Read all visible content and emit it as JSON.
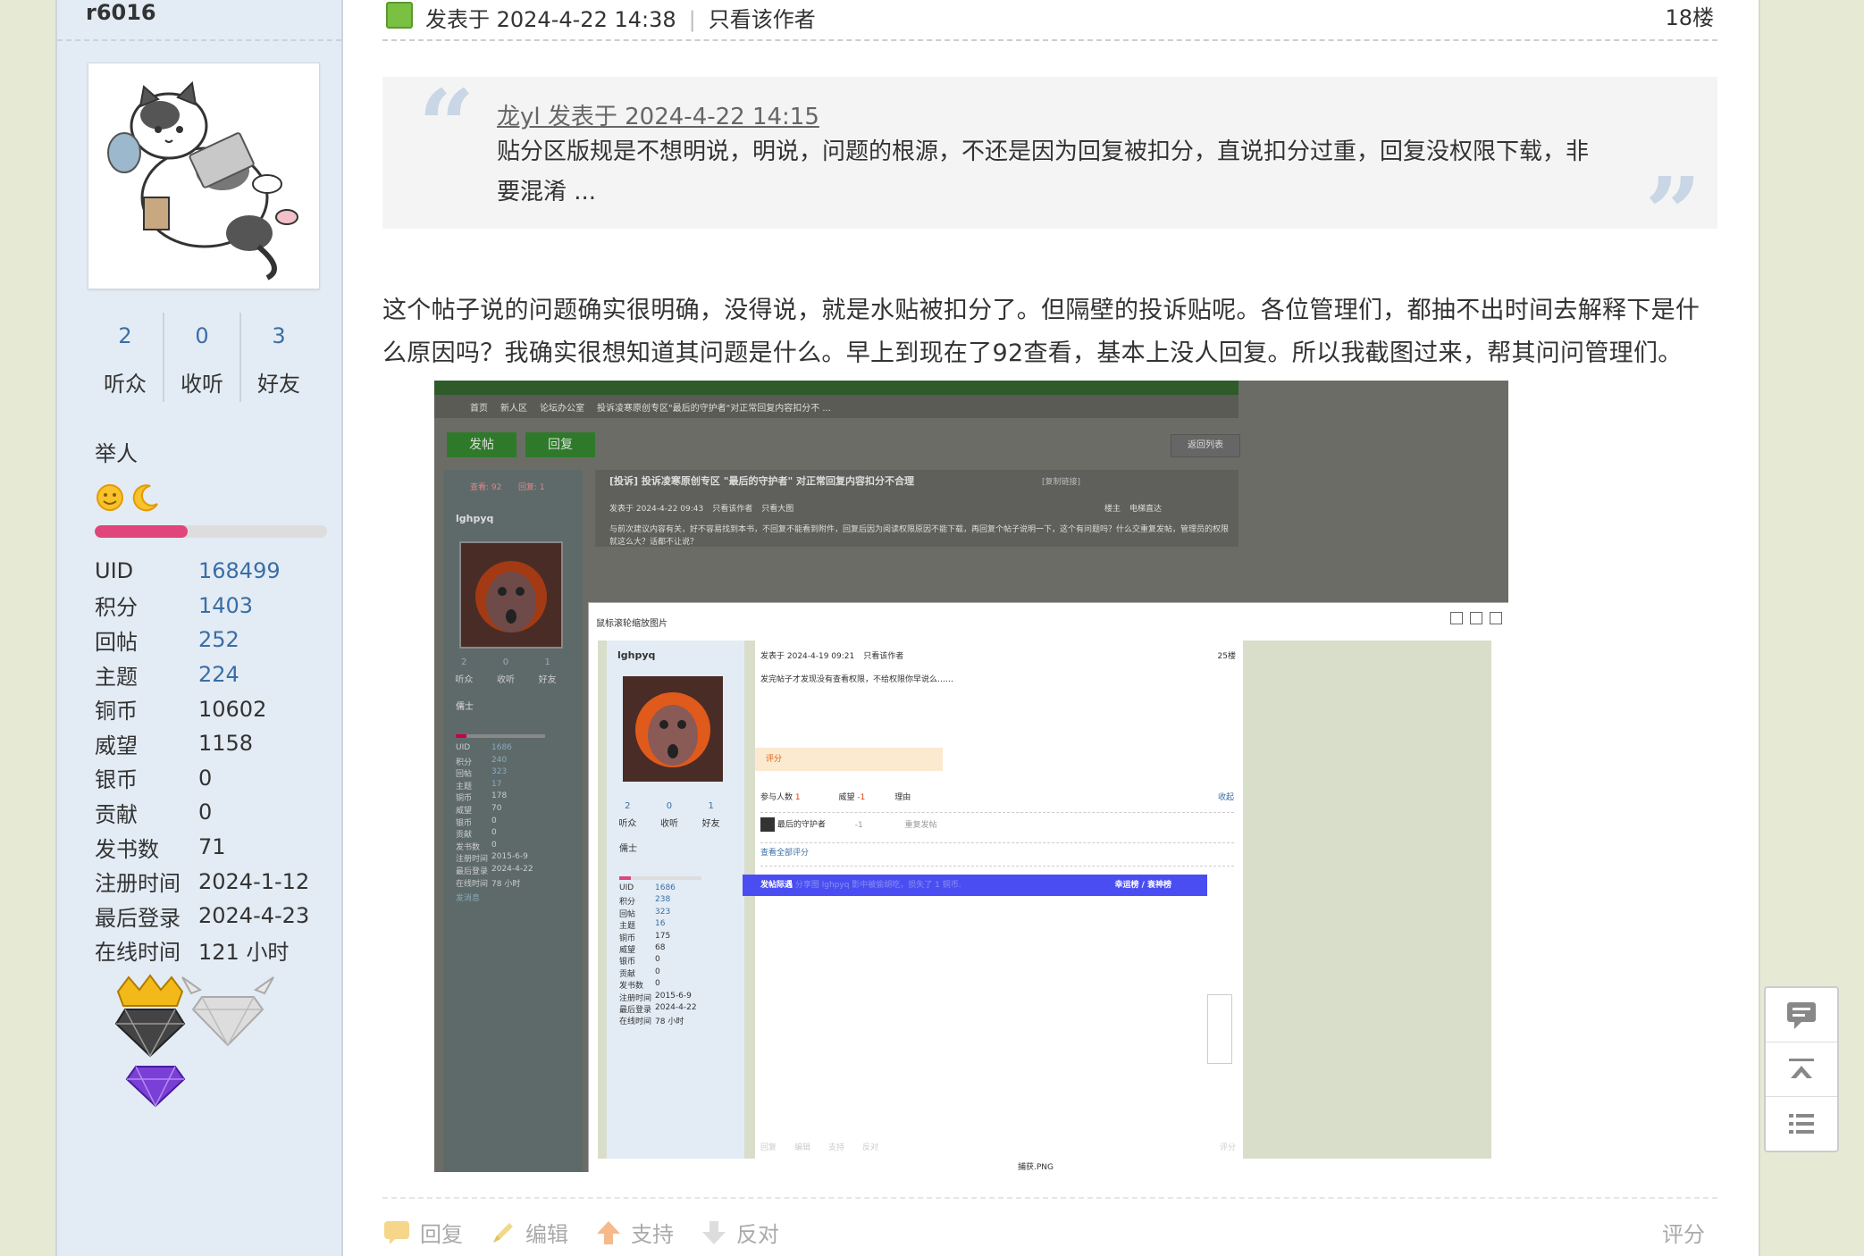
{
  "user": {
    "name": "r6016",
    "stats": [
      {
        "num": "2",
        "label": "听众"
      },
      {
        "num": "0",
        "label": "收听"
      },
      {
        "num": "3",
        "label": "好友"
      }
    ],
    "rank": "举人",
    "progress": 0.4,
    "info": [
      {
        "k": "UID",
        "v": "168499"
      },
      {
        "k": "积分",
        "v": "1403"
      },
      {
        "k": "回帖",
        "v": "252"
      },
      {
        "k": "主题",
        "v": "224"
      },
      {
        "k": "铜币",
        "v": "10602"
      },
      {
        "k": "威望",
        "v": "1158"
      },
      {
        "k": "银币",
        "v": "0"
      },
      {
        "k": "贡献",
        "v": "0"
      },
      {
        "k": "发书数",
        "v": "71"
      },
      {
        "k": "注册时间",
        "v": "2024-1-12"
      },
      {
        "k": "最后登录",
        "v": "2024-4-23"
      },
      {
        "k": "在线时间",
        "v": "121 小时"
      }
    ]
  },
  "post": {
    "posted": "发表于 2024-4-22 14:38",
    "only_author": "只看该作者",
    "floor": "18楼",
    "quote_author": "龙yl 发表于 2024-4-22 14:15",
    "quote_text": "贴分区版规是不想明说，明说，问题的根源，不还是因为回复被扣分，直说扣分过重，回复没权限下载，非要混淆 ...",
    "body": "这个帖子说的问题确实很明确，没得说，就是水贴被扣分了。但隔壁的投诉贴呢。各位管理们，都抽不出时间去解释下是什么原因吗？我确实很想知道其问题是什么。早上到现在了92查看，基本上没人回复。所以我截图过来，帮其问问管理们。",
    "actions": {
      "reply": "回复",
      "edit": "编辑",
      "support": "支持",
      "oppose": "反对"
    },
    "rate": "评分"
  },
  "screenshot": {
    "nav_home": "首页",
    "nav_new": "新人区",
    "nav_office": "论坛办公室",
    "nav_thread": "投诉凌寒原创专区\"最后的守护者\"对正常回复内容扣分不 ...",
    "btn_post": "发帖",
    "btn_reply": "回复",
    "back_list": "返回列表",
    "views": "查看: 92",
    "replies": "回复: 1",
    "thread_title": "[投诉] 投诉凌寒原创专区 \"最后的守护者\" 对正常回复内容扣分不合理",
    "copy_link": "[复制链接]",
    "author": "lghpyq",
    "posted": "发表于 2024-4-22 09:43",
    "only_author": "只看该作者",
    "big_img": "只看大图",
    "host": "楼主",
    "elevator": "电梯直达",
    "body": "与前次建议内容有关，好不容易找到本书，不回复不能看到附件，回复后因为阅读权限原因不能下载，再回复个帖子说明一下，这个有问题吗？什么交重复发帖，管理员的权限就这么大？话都不让说？",
    "side_stats": [
      "2",
      "0",
      "1"
    ],
    "side_labels": [
      "听众",
      "收听",
      "好友"
    ],
    "side_rank": "儒士",
    "side_info": [
      [
        "UID",
        "1686"
      ],
      [
        "积分",
        "240"
      ],
      [
        "回帖",
        "323"
      ],
      [
        "主题",
        "17"
      ],
      [
        "铜币",
        "178"
      ],
      [
        "威望",
        "70"
      ],
      [
        "银币",
        "0"
      ],
      [
        "贡献",
        "0"
      ],
      [
        "发书数",
        "0"
      ],
      [
        "注册时间",
        "2015-6-9"
      ],
      [
        "最后登录",
        "2024-4-22"
      ],
      [
        "在线时间",
        "78 小时"
      ]
    ],
    "send_msg": "发消息",
    "popup_title": "鼠标滚轮缩放图片",
    "inner_posted": "发表于 2024-4-19 09:21",
    "inner_only": "只看该作者",
    "inner_floor": "25楼",
    "inner_body": "发完帖子才发现没有查看权限，不给权限你早说么……",
    "rate_label": "评分",
    "participants": "参与人数",
    "participants_n": "1",
    "prestige": "威望",
    "prestige_n": "-1",
    "reason": "理由",
    "collapse": "收起",
    "rater": "最后的守护者",
    "rater_val": "-1",
    "rater_reason": "重复发帖",
    "view_all": "查看全部评分",
    "banner_tag": "发帖际遇",
    "banner_text": "分享图 lghpyq 影中被偷胡吃，损失了 1 铜币.",
    "banner_right": "幸运榜 / 衰神榜",
    "inner_info": [
      [
        "UID",
        "1686"
      ],
      [
        "积分",
        "238"
      ],
      [
        "回帖",
        "323"
      ],
      [
        "主题",
        "16"
      ],
      [
        "铜币",
        "175"
      ],
      [
        "威望",
        "68"
      ],
      [
        "银币",
        "0"
      ],
      [
        "贡献",
        "0"
      ],
      [
        "发书数",
        "0"
      ],
      [
        "注册时间",
        "2015-6-9"
      ],
      [
        "最后登录",
        "2024-4-22"
      ],
      [
        "在线时间",
        "78 小时"
      ]
    ],
    "inner_actions": [
      "回复",
      "编辑",
      "支持",
      "反对"
    ],
    "inner_rate": "评分",
    "filename": "捕获.PNG"
  }
}
